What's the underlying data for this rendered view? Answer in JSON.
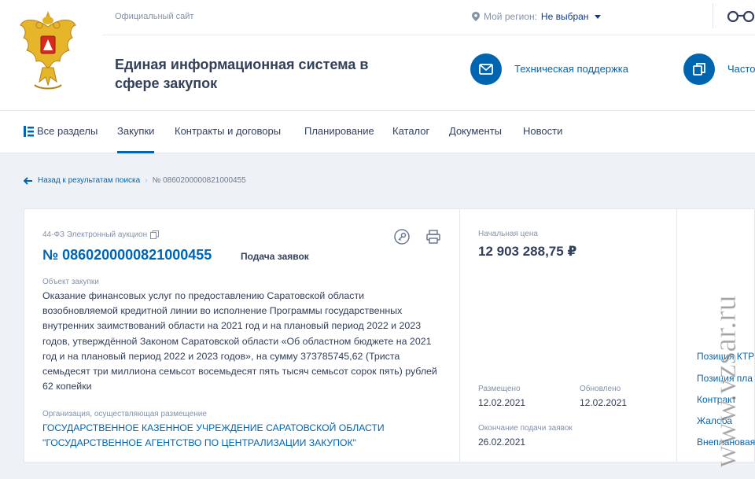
{
  "header": {
    "official": "Официальный сайт",
    "region_label": "Мой регион:",
    "region_value": "Не выбран",
    "title": "Единая информационная система в сфере закупок",
    "support": "Техническая поддержка",
    "faq": "Часто"
  },
  "nav": {
    "all": "Все разделы",
    "items": [
      "Закупки",
      "Контракты и договоры",
      "Планирование",
      "Каталог",
      "Документы",
      "Новости"
    ]
  },
  "breadcrumb": {
    "back": "Назад к результатам поиска",
    "current": "№ 0860200000821000455"
  },
  "purchase": {
    "law": "44-ФЗ Электронный аукцион",
    "number": "№ 0860200000821000455",
    "stage": "Подача заявок",
    "object_label": "Объект закупки",
    "object": "Оказание финансовых услуг по предоставлению Саратовской области возобновляемой кредитной линии во исполнение Программы государственных внутренних заимствований области на 2021 год и на плановый период 2022 и 2023 годов, утверждённой Законом Саратовской области «Об областном бюджете на 2021 год и на плановый период 2022 и 2023 годов», на сумму 373785745,62 (Триста семьдесят три миллиона семьсот восемьдесят пять тысяч семьсот сорок пять) рублей 62 копейки",
    "org_label": "Организация, осуществляющая размещение",
    "org": "ГОСУДАРСТВЕННОЕ КАЗЕННОЕ УЧРЕЖДЕНИЕ САРАТОВСКОЙ ОБЛАСТИ \"ГОСУДАРСТВЕННОЕ АГЕНТСТВО ПО ЦЕНТРАЛИЗАЦИИ ЗАКУПОК\""
  },
  "price": {
    "label": "Начальная цена",
    "value": "12 903 288,75 ₽"
  },
  "dates": {
    "placed_label": "Размещено",
    "placed": "12.02.2021",
    "updated_label": "Обновлено",
    "updated": "12.02.2021",
    "deadline_label": "Окончание подачи заявок",
    "deadline": "26.02.2021"
  },
  "side_links": [
    "Позиция КТР",
    "Позиция пла",
    "Контракт",
    "Жалоба",
    "Внеплановая"
  ],
  "watermark": "www.vzsar.ru",
  "colors": {
    "accent": "#0065b1",
    "text": "#334059",
    "muted": "#8492a6",
    "bg": "#eef2f6"
  }
}
